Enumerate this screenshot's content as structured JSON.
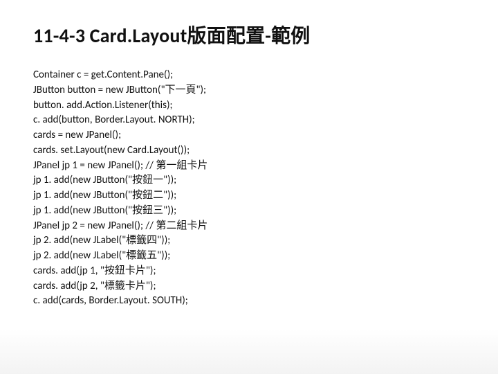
{
  "title": "11-4-3 Card.Layout版面配置-範例",
  "code": [
    "Container c = get.Content.Pane();",
    "JButton button = new JButton(\"下一頁\");",
    "button. add.Action.Listener(this);",
    "c. add(button, Border.Layout. NORTH);",
    "cards = new JPanel();",
    "cards. set.Layout(new Card.Layout());",
    "JPanel jp 1 = new JPanel(); // 第一組卡片",
    "jp 1. add(new JButton(\"按鈕一\"));",
    "jp 1. add(new JButton(\"按鈕二\"));",
    "jp 1. add(new JButton(\"按鈕三\"));",
    "JPanel jp 2 = new JPanel(); // 第二組卡片",
    "jp 2. add(new JLabel(\"標籤四\"));",
    "jp 2. add(new JLabel(\"標籤五\"));",
    "cards. add(jp 1, \"按鈕卡片\");",
    "cards. add(jp 2, \"標籤卡片\");",
    "c. add(cards, Border.Layout. SOUTH);"
  ]
}
